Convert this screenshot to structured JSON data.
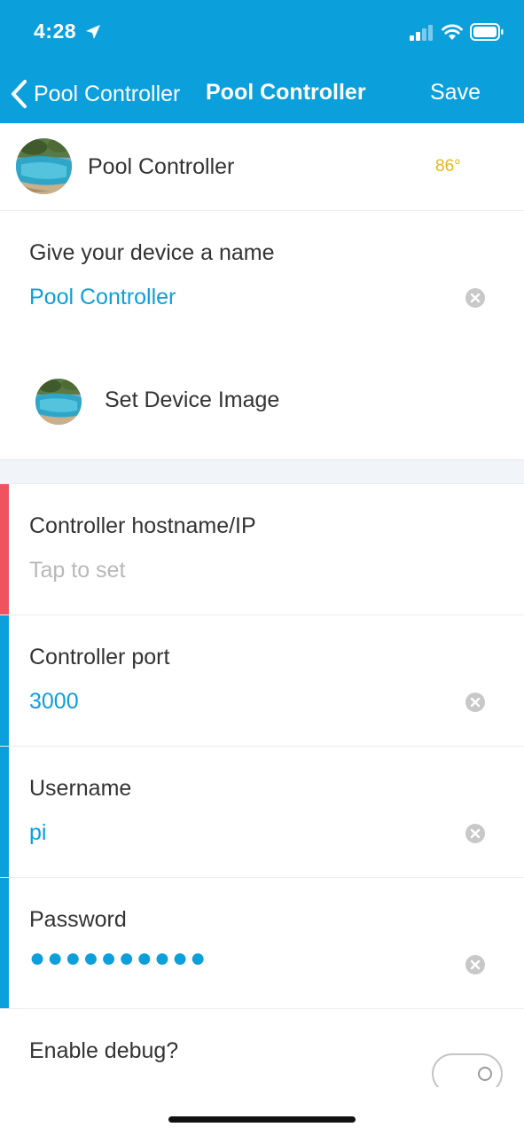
{
  "status_bar": {
    "time": "4:28",
    "icons": [
      "location-arrow-icon",
      "signal-icon",
      "wifi-icon",
      "battery-icon"
    ]
  },
  "nav": {
    "back_label": "Pool Controller",
    "title": "Pool Controller",
    "save_label": "Save"
  },
  "device": {
    "name": "Pool Controller",
    "temperature": "86°",
    "image_icon": "pool-photo-avatar"
  },
  "name_field": {
    "label": "Give your device a name",
    "value": "Pool Controller"
  },
  "set_image": {
    "label": "Set Device Image"
  },
  "fields": [
    {
      "label": "Controller hostname/IP",
      "value": "",
      "placeholder": "Tap to set",
      "status": "required"
    },
    {
      "label": "Controller port",
      "value": "3000",
      "status": "ok"
    },
    {
      "label": "Username",
      "value": "pi",
      "status": "ok"
    },
    {
      "label": "Password",
      "value": "●●●●●●●●●●",
      "status": "ok"
    }
  ],
  "debug": {
    "label": "Enable debug?",
    "enabled": false
  },
  "colors": {
    "accent": "#0b9fdc",
    "required_stripe": "#ef5360",
    "ok_stripe": "#0b9fdc",
    "temperature": "#e5b81b",
    "separator": "#f1f5fa"
  }
}
